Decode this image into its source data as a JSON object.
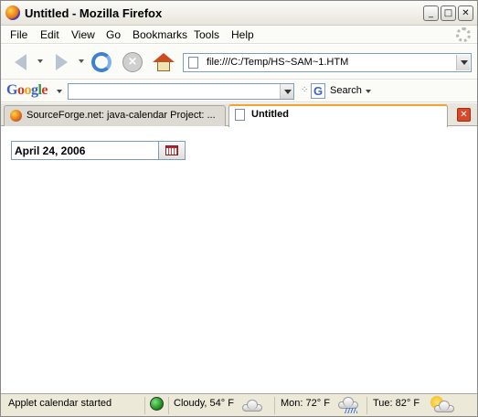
{
  "window": {
    "title": "Untitled - Mozilla Firefox",
    "controls": {
      "minimize": "_",
      "maximize": "□",
      "close": "✕"
    }
  },
  "menubar": {
    "items": [
      "File",
      "Edit",
      "View",
      "Go",
      "Bookmarks",
      "Tools",
      "Help"
    ]
  },
  "navbar": {
    "url": "file:///C:/Temp/HS~SAM~1.HTM",
    "icons": [
      "back-arrow-icon",
      "forward-arrow-icon",
      "reload-icon",
      "stop-icon",
      "home-icon",
      "page-icon"
    ]
  },
  "google_toolbar": {
    "logo": "Google",
    "search_value": "",
    "search_label": "Search"
  },
  "tabs": [
    {
      "label": "SourceForge.net: java-calendar Project: ...",
      "active": false
    },
    {
      "label": "Untitled",
      "active": true
    }
  ],
  "page": {
    "date_value": "April 24, 2006"
  },
  "statusbar": {
    "status_text": "Applet calendar started",
    "weather_now": "Cloudy, 54° F",
    "weather_mon": "Mon: 72° F",
    "weather_tue": "Tue: 82° F"
  },
  "colors": {
    "active_tab_accent": "#f2a535",
    "tab_close": "#d8492b",
    "status_indicator": "#138a13"
  }
}
